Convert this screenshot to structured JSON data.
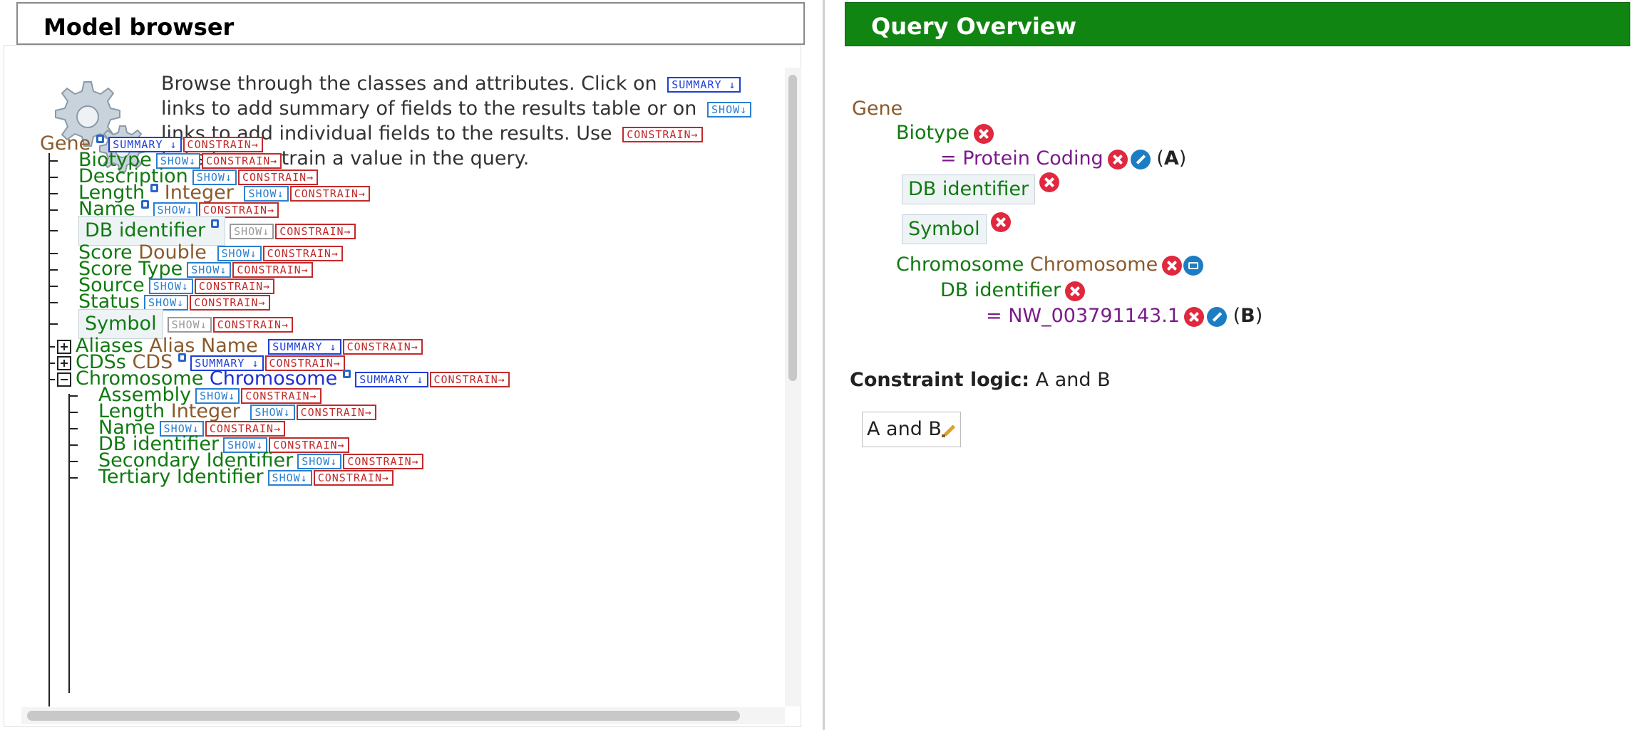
{
  "left_panel": {
    "title": "Model browser",
    "intro": {
      "part1": "Browse through the classes and attributes. Click on",
      "part2": "links to add summary of fields to the results table or on",
      "part3": "links to add individual fields to the results. Use",
      "part4": "links to constrain a value in the query."
    },
    "tags": {
      "summary": "SUMMARY ↓",
      "show": "SHOW↓",
      "constrain": "CONSTRAIN→"
    },
    "root": {
      "label": "Gene"
    },
    "fields": [
      {
        "label": "Biotype",
        "type": ""
      },
      {
        "label": "Description",
        "type": ""
      },
      {
        "label": "Length",
        "type": "Integer"
      },
      {
        "label": "Name",
        "type": ""
      },
      {
        "label": "DB identifier",
        "type": ""
      },
      {
        "label": "Score",
        "type": "Double"
      },
      {
        "label": "Score Type",
        "type": ""
      },
      {
        "label": "Source",
        "type": ""
      },
      {
        "label": "Status",
        "type": ""
      },
      {
        "label": "Symbol",
        "type": ""
      }
    ],
    "collections": [
      {
        "label": "Aliases",
        "type": "Alias Name"
      },
      {
        "label": "CDSs",
        "type": "CDS"
      },
      {
        "label": "Chromosome",
        "type": "Chromosome"
      }
    ],
    "chromosome_fields": [
      {
        "label": "Assembly",
        "type": ""
      },
      {
        "label": "Length",
        "type": "Integer"
      },
      {
        "label": "Name",
        "type": ""
      },
      {
        "label": "DB identifier",
        "type": ""
      },
      {
        "label": "Secondary Identifier",
        "type": ""
      },
      {
        "label": "Tertiary Identifier",
        "type": ""
      }
    ]
  },
  "right_panel": {
    "title": "Query Overview",
    "root": "Gene",
    "biotype": {
      "label": "Biotype",
      "value": "= Protein Coding",
      "code_open": "(",
      "code": "A",
      "code_close": ")"
    },
    "db_identifier": "DB identifier",
    "symbol": "Symbol",
    "chromosome": {
      "label": "Chromosome",
      "type": "Chromosome"
    },
    "chrom_db": {
      "label": "DB identifier",
      "value": "= NW_003791143.1",
      "code_open": "(",
      "code": "B",
      "code_close": ")"
    },
    "logic": {
      "label": "Constraint logic:",
      "value": "A and B",
      "box": "A and B"
    }
  },
  "colors": {
    "header_green": "#118511",
    "field_green": "#107a10",
    "type_brown": "#8a5a2b",
    "ref_blue": "#1d2fd4",
    "value_purple": "#7a1a8a",
    "remove_red": "#e0283e"
  }
}
